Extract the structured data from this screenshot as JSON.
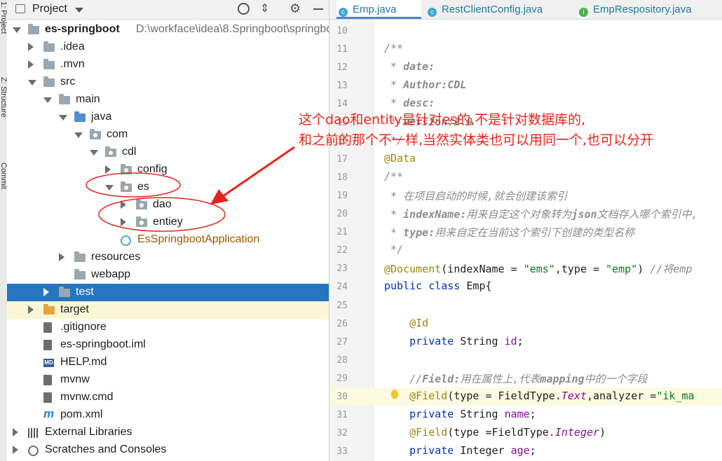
{
  "left_stripe": {
    "labels": [
      "1: Project",
      "Z: Structure",
      "Commit"
    ]
  },
  "project_panel": {
    "title": "Project",
    "tree": [
      {
        "label": "es-springboot",
        "path": "D:\\workface\\idea\\8.Springboot\\springbo",
        "indent": 0,
        "expander": "down",
        "icon": "module-folder"
      },
      {
        "label": ".idea",
        "indent": 1,
        "expander": "right",
        "icon": "folder"
      },
      {
        "label": ".mvn",
        "indent": 1,
        "expander": "right",
        "icon": "folder"
      },
      {
        "label": "src",
        "indent": 1,
        "expander": "down",
        "icon": "folder"
      },
      {
        "label": "main",
        "indent": 2,
        "expander": "down",
        "icon": "folder"
      },
      {
        "label": "java",
        "indent": 3,
        "expander": "down",
        "icon": "blue-folder"
      },
      {
        "label": "com",
        "indent": 4,
        "expander": "down",
        "icon": "package"
      },
      {
        "label": "cdl",
        "indent": 5,
        "expander": "down",
        "icon": "package"
      },
      {
        "label": "config",
        "indent": 6,
        "expander": "right",
        "icon": "package"
      },
      {
        "label": "es",
        "indent": 6,
        "expander": "down",
        "icon": "package"
      },
      {
        "label": "dao",
        "indent": 7,
        "expander": "right",
        "icon": "package"
      },
      {
        "label": "entiey",
        "indent": 7,
        "expander": "right",
        "icon": "package"
      },
      {
        "label": "EsSpringbootApplication",
        "indent": 6,
        "expander": "none",
        "icon": "spring-class",
        "color": "#9e5a00"
      },
      {
        "label": "resources",
        "indent": 3,
        "expander": "right",
        "icon": "resources-folder"
      },
      {
        "label": "webapp",
        "indent": 3,
        "expander": "none",
        "icon": "folder"
      },
      {
        "label": "test",
        "indent": 2,
        "expander": "right",
        "icon": "folder",
        "selected": true
      },
      {
        "label": "target",
        "indent": 1,
        "expander": "right",
        "icon": "orange-folder",
        "highlighted": true
      },
      {
        "label": ".gitignore",
        "indent": 1,
        "expander": "none",
        "icon": "file"
      },
      {
        "label": "es-springboot.iml",
        "indent": 1,
        "expander": "none",
        "icon": "file"
      },
      {
        "label": "HELP.md",
        "indent": 1,
        "expander": "none",
        "icon": "md-file"
      },
      {
        "label": "mvnw",
        "indent": 1,
        "expander": "none",
        "icon": "terminal-file"
      },
      {
        "label": "mvnw.cmd",
        "indent": 1,
        "expander": "none",
        "icon": "file"
      },
      {
        "label": "pom.xml",
        "indent": 1,
        "expander": "none",
        "icon": "maven-file"
      },
      {
        "label": "External Libraries",
        "indent": 0,
        "expander": "right",
        "icon": "libraries"
      },
      {
        "label": "Scratches and Consoles",
        "indent": 0,
        "expander": "right",
        "icon": "scratches"
      }
    ]
  },
  "editor_tabs": [
    {
      "label": "Emp.java",
      "icon": "c",
      "active": true
    },
    {
      "label": "RestClientConfig.java",
      "icon": "c",
      "active": false
    },
    {
      "label": "EmpRespository.java",
      "icon": "i",
      "active": false
    }
  ],
  "code_lines": [
    {
      "n": "10",
      "html": ""
    },
    {
      "n": "11",
      "html": "<span class=\"doc\">/**</span>"
    },
    {
      "n": "12",
      "html": "<span class=\"doc\"> * </span><span class=\"tag\">date:</span>"
    },
    {
      "n": "13",
      "html": "<span class=\"doc\"> * </span><span class=\"tag\">Author:CDL</span>"
    },
    {
      "n": "14",
      "html": "<span class=\"doc\"> * </span><span class=\"tag\">desc:</span>"
    },
    {
      "n": "15",
      "html": "<span class=\"doc\"> * </span><span class=\"tag\">version:1.0</span>"
    },
    {
      "n": "16",
      "html": "<span class=\"doc\"> */</span>"
    },
    {
      "n": "17",
      "html": "<span class=\"ann\">@Data</span>"
    },
    {
      "n": "18",
      "html": "<span class=\"doc\">/**</span>"
    },
    {
      "n": "19",
      "html": "<span class=\"doc\"> * 在项目启动的时候,就会创建该索引</span>"
    },
    {
      "n": "20",
      "html": "<span class=\"doc\"> * </span><span class=\"tag\">indexName:</span><span class=\"doc\">用来自定这个对象转为</span><span class=\"tag\">json</span><span class=\"doc\">文档存入哪个索引中,</span>"
    },
    {
      "n": "21",
      "html": "<span class=\"doc\"> * </span><span class=\"tag\">type:</span><span class=\"doc\">用来自定在当前这个索引下创建的类型名称</span>"
    },
    {
      "n": "22",
      "html": "<span class=\"doc\"> */</span>"
    },
    {
      "n": "23",
      "html": "<span class=\"ann\">@Document</span>(indexName = <span class=\"str\">\"ems\"</span>,type = <span class=\"str\">\"emp\"</span>) <span class=\"cm\">//将emp</span>"
    },
    {
      "n": "24",
      "html": "<span class=\"kw\">public class</span> Emp{"
    },
    {
      "n": "25",
      "html": ""
    },
    {
      "n": "26",
      "html": "    <span class=\"ann\">@Id</span>"
    },
    {
      "n": "27",
      "html": "    <span class=\"kw\">private</span> String <span class=\"fld\">id</span>;"
    },
    {
      "n": "28",
      "html": ""
    },
    {
      "n": "29",
      "html": "    <span class=\"cm\">//</span><span class=\"tag\">Field:</span><span class=\"cm\">用在属性上,代表</span><span class=\"tag\">mapping</span><span class=\"cm\">中的一个字段</span>"
    },
    {
      "n": "30",
      "html": "    <span class=\"ann\">@Field</span>(type = FieldType.<span class=\"ital\">Text</span>,analyzer =<span class=\"str\">\"ik_ma</span>",
      "current": true
    },
    {
      "n": "31",
      "html": "    <span class=\"kw\">private</span> String <span class=\"fld\">name</span>;"
    },
    {
      "n": "32",
      "html": "    <span class=\"ann\">@Field</span>(type =FieldType.<span class=\"ital\">Integer</span>)"
    },
    {
      "n": "33",
      "html": "    <span class=\"kw\">private</span> Integer <span class=\"fld\">age</span>;"
    }
  ],
  "annotation": {
    "line1": "这个dao和entity是针对es的,不是针对数据库的,",
    "line2": "和之前的那个不一样,当然实体类也可以用同一个,也可以分开",
    "color": "#e8231a"
  }
}
